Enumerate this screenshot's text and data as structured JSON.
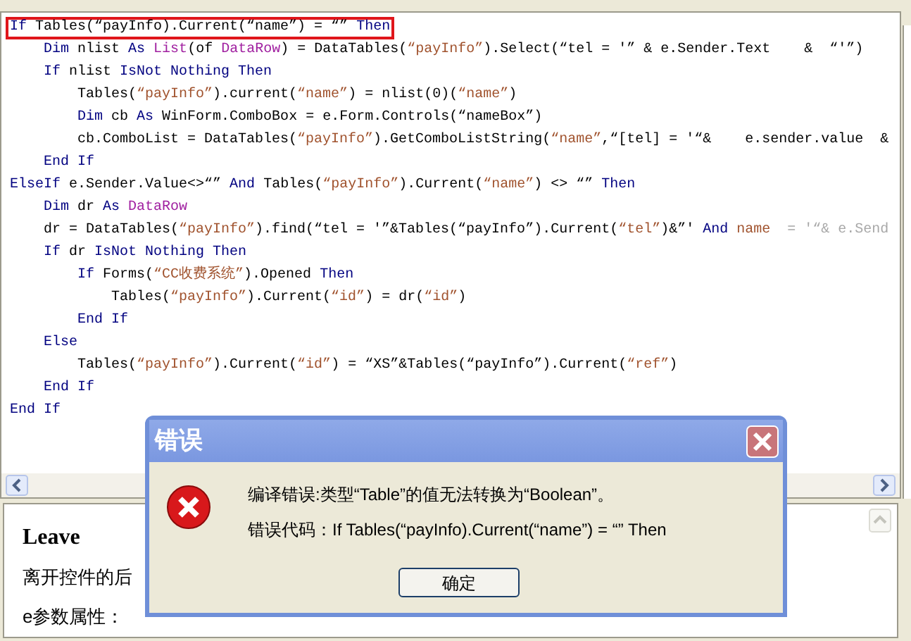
{
  "code": [
    {
      "boxed": true,
      "tokens": [
        {
          "kind": "kw",
          "text": "If"
        },
        {
          "kind": "plain",
          "text": " Tables(“payInfo).Current(“name”) = “” "
        },
        {
          "kind": "kw",
          "text": "Then"
        }
      ],
      "children": [
        {
          "tokens": [
            {
              "kind": "kw",
              "text": "Dim"
            },
            {
              "kind": "plain",
              "text": " nlist "
            },
            {
              "kind": "kw",
              "text": "As"
            },
            {
              "kind": "type",
              "text": " List"
            },
            {
              "kind": "plain",
              "text": "(of "
            },
            {
              "kind": "type",
              "text": "DataRow"
            },
            {
              "kind": "plain",
              "text": ") = DataTables("
            },
            {
              "kind": "str",
              "text": "“payInfo”"
            },
            {
              "kind": "plain",
              "text": ").Select(“tel = '” & e.Sender.Text    &  “'”)"
            }
          ]
        },
        {
          "tokens": [
            {
              "kind": "kw",
              "text": "If"
            },
            {
              "kind": "plain",
              "text": " nlist "
            },
            {
              "kind": "kw",
              "text": "IsNot Nothing Then"
            }
          ],
          "children": [
            {
              "tokens": [
                {
                  "kind": "plain",
                  "text": "Tables("
                },
                {
                  "kind": "str",
                  "text": "“payInfo”"
                },
                {
                  "kind": "plain",
                  "text": ").current("
                },
                {
                  "kind": "str",
                  "text": "“name”"
                },
                {
                  "kind": "plain",
                  "text": ") = nlist(0)("
                },
                {
                  "kind": "str",
                  "text": "“name”"
                },
                {
                  "kind": "plain",
                  "text": ")"
                }
              ]
            },
            {
              "tokens": [
                {
                  "kind": "kw",
                  "text": "Dim"
                },
                {
                  "kind": "plain",
                  "text": " cb "
                },
                {
                  "kind": "kw",
                  "text": "As"
                },
                {
                  "kind": "plain",
                  "text": " WinForm.ComboBox = e.Form.Controls(“nameBox”)"
                }
              ]
            },
            {
              "tokens": [
                {
                  "kind": "plain",
                  "text": "cb.ComboList = DataTables("
                },
                {
                  "kind": "str",
                  "text": "“payInfo”"
                },
                {
                  "kind": "plain",
                  "text": ").GetComboListString("
                },
                {
                  "kind": "str",
                  "text": "“name”"
                },
                {
                  "kind": "plain",
                  "text": ",“[tel] = '“&    e.sender.value  &"
                }
              ]
            }
          ]
        },
        {
          "tokens": [
            {
              "kind": "kw",
              "text": "End If"
            }
          ]
        }
      ]
    },
    {
      "tokens": [
        {
          "kind": "kw",
          "text": "ElseIf"
        },
        {
          "kind": "plain",
          "text": " e.Sender.Value<>“” "
        },
        {
          "kind": "kw",
          "text": "And"
        },
        {
          "kind": "plain",
          "text": " Tables("
        },
        {
          "kind": "str",
          "text": "“payInfo”"
        },
        {
          "kind": "plain",
          "text": ").Current("
        },
        {
          "kind": "str",
          "text": "“name”"
        },
        {
          "kind": "plain",
          "text": ") <> “” "
        },
        {
          "kind": "kw",
          "text": "Then"
        }
      ],
      "children": [
        {
          "tokens": [
            {
              "kind": "kw",
              "text": "Dim"
            },
            {
              "kind": "plain",
              "text": " dr "
            },
            {
              "kind": "kw",
              "text": "As"
            },
            {
              "kind": "type",
              "text": " DataRow"
            }
          ]
        },
        {
          "tokens": [
            {
              "kind": "plain",
              "text": "dr = DataTables("
            },
            {
              "kind": "str",
              "text": "“payInfo”"
            },
            {
              "kind": "plain",
              "text": ").find(“tel = '”&Tables(“payInfo”).Current("
            },
            {
              "kind": "str",
              "text": "“tel”"
            },
            {
              "kind": "plain",
              "text": ")&”' "
            },
            {
              "kind": "kw",
              "text": "And"
            },
            {
              "kind": "str",
              "text": " name"
            },
            {
              "kind": "faded",
              "text": "  = '“& e.Send"
            }
          ]
        },
        {
          "tokens": [
            {
              "kind": "kw",
              "text": "If"
            },
            {
              "kind": "plain",
              "text": " dr "
            },
            {
              "kind": "kw",
              "text": "IsNot Nothing Then"
            }
          ],
          "children": [
            {
              "tokens": [
                {
                  "kind": "kw",
                  "text": "If"
                },
                {
                  "kind": "plain",
                  "text": " Forms("
                },
                {
                  "kind": "str",
                  "text": "“CC收费系统”"
                },
                {
                  "kind": "plain",
                  "text": ").Opened "
                },
                {
                  "kind": "kw",
                  "text": "Then"
                }
              ],
              "children": [
                {
                  "tokens": [
                    {
                      "kind": "plain",
                      "text": "Tables("
                    },
                    {
                      "kind": "str",
                      "text": "“payInfo”"
                    },
                    {
                      "kind": "plain",
                      "text": ").Current("
                    },
                    {
                      "kind": "str",
                      "text": "“id”"
                    },
                    {
                      "kind": "plain",
                      "text": ") = dr("
                    },
                    {
                      "kind": "str",
                      "text": "“id”"
                    },
                    {
                      "kind": "plain",
                      "text": ")"
                    }
                  ]
                }
              ]
            },
            {
              "tokens": [
                {
                  "kind": "kw",
                  "text": "End If"
                }
              ]
            }
          ]
        },
        {
          "tokens": [
            {
              "kind": "kw",
              "text": "Else"
            }
          ],
          "children": [
            {
              "tokens": [
                {
                  "kind": "plain",
                  "text": "Tables("
                },
                {
                  "kind": "str",
                  "text": "“payInfo”"
                },
                {
                  "kind": "plain",
                  "text": ").Current("
                },
                {
                  "kind": "str",
                  "text": "“id”"
                },
                {
                  "kind": "plain",
                  "text": ") = “XS”&Tables(“payInfo”).Current("
                },
                {
                  "kind": "str",
                  "text": "“ref”"
                },
                {
                  "kind": "plain",
                  "text": ")"
                }
              ]
            }
          ]
        },
        {
          "tokens": [
            {
              "kind": "kw",
              "text": "End If"
            }
          ]
        }
      ]
    },
    {
      "tokens": [
        {
          "kind": "kw",
          "text": "End If"
        }
      ]
    }
  ],
  "help": {
    "title": "Leave",
    "lines": [
      "离开控件的后",
      "e参数属性："
    ]
  },
  "dialog": {
    "title": "错误",
    "message": "编译错误:类型“Table”的值无法转换为“Boolean”。",
    "detail": "错误代码：If Tables(“payInfo).Current(“name”) = “” Then",
    "button": "确定"
  }
}
